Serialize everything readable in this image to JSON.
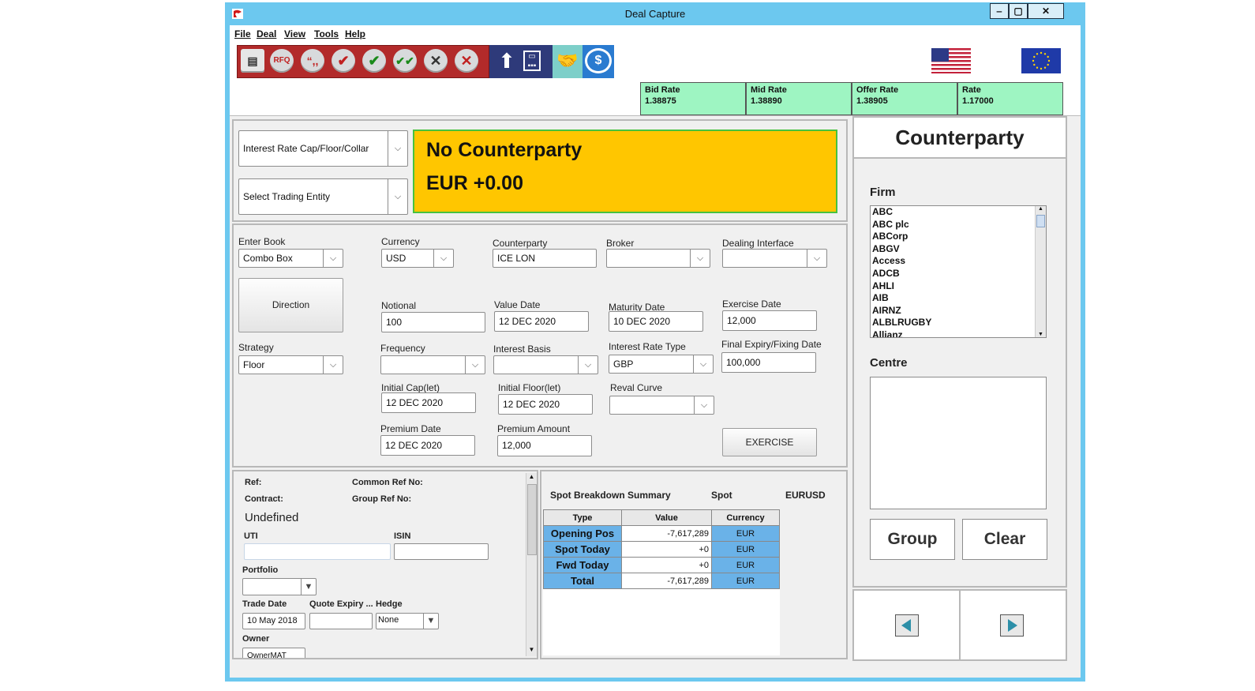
{
  "window": {
    "title": "Deal Capture",
    "controls": {
      "minimize": "‒",
      "maximize": "▢",
      "close": "✕"
    }
  },
  "menu": [
    "File",
    "Deal",
    "View",
    "Tools",
    "Help"
  ],
  "toolbar": {
    "rfq_label": "RFQ",
    "quote_label": "“,,",
    "icons": [
      "new-deal-icon",
      "rfq-icon",
      "quote-icon",
      "check-icon",
      "check-icon",
      "double-check-icon",
      "cancel-icon",
      "delete-icon",
      "upload-icon",
      "calculator-icon",
      "handshake-icon",
      "currency-refresh-icon"
    ]
  },
  "flags": {
    "left": "us-flag-icon",
    "right": "eu-flag-icon"
  },
  "rates": [
    {
      "label": "Bid Rate",
      "value": "1.38875"
    },
    {
      "label": "Mid Rate",
      "value": "1.38890"
    },
    {
      "label": "Offer Rate",
      "value": "1.38905"
    },
    {
      "label": "Rate",
      "value": "1.17000"
    }
  ],
  "deal_type": {
    "product": "Interest Rate Cap/Floor/Collar",
    "trading_entity": "Select Trading Entity"
  },
  "summary_banner": {
    "counterparty": "No Counterparty",
    "amount": "EUR +0.00"
  },
  "form": {
    "enter_book": {
      "label": "Enter Book",
      "value": "Combo Box"
    },
    "currency": {
      "label": "Currency",
      "value": "USD"
    },
    "counterparty": {
      "label": "Counterparty",
      "value": "ICE LON"
    },
    "broker": {
      "label": "Broker",
      "value": ""
    },
    "dealing_interface": {
      "label": "Dealing Interface",
      "value": ""
    },
    "direction_button": "Direction",
    "notional": {
      "label": "Notional",
      "value": "100"
    },
    "value_date": {
      "label": "Value Date",
      "value": "12 DEC 2020"
    },
    "maturity_date": {
      "label": "Maturity Date",
      "value": "10 DEC 2020"
    },
    "exercise_date": {
      "label": "Exercise Date",
      "value": "12,000"
    },
    "strategy": {
      "label": "Strategy",
      "value": "Floor"
    },
    "frequency": {
      "label": "Frequency",
      "value": ""
    },
    "interest_basis": {
      "label": "Interest Basis",
      "value": ""
    },
    "interest_rate_type": {
      "label": "Interest Rate Type",
      "value": "GBP"
    },
    "final_expiry": {
      "label": "Final Expiry/Fixing Date",
      "value": "100,000"
    },
    "initial_cap": {
      "label": "Initial Cap(let)",
      "value": "12 DEC 2020"
    },
    "initial_floor": {
      "label": "Initial Floor(let)",
      "value": "12 DEC 2020"
    },
    "reval_curve": {
      "label": "Reval Curve",
      "value": ""
    },
    "premium_date": {
      "label": "Premium Date",
      "value": "12 DEC 2020"
    },
    "premium_amount": {
      "label": "Premium Amount",
      "value": "12,000"
    },
    "exercise_button": "EXERCISE"
  },
  "ref_panel": {
    "ref_label": "Ref:",
    "common_ref_label": "Common Ref No:",
    "contract_label": "Contract:",
    "group_ref_label": "Group Ref No:",
    "status": "Undefined",
    "uti_label": "UTI",
    "uti_value": "",
    "isin_label": "ISIN",
    "isin_value": "",
    "portfolio_label": "Portfolio",
    "portfolio_value": "",
    "trade_date_label": "Trade Date",
    "trade_date_value": "10 May 2018",
    "quote_expiry_label": "Quote Expiry ...",
    "quote_expiry_value": "",
    "hedge_label": "Hedge",
    "hedge_value": "None",
    "owner_label": "Owner",
    "owner_value": "OwnerMAT"
  },
  "spot_breakdown": {
    "title": "Spot Breakdown Summary",
    "spot_label": "Spot",
    "pair": "EURUSD",
    "columns": [
      "Type",
      "Value",
      "Currency"
    ],
    "rows": [
      {
        "type": "Opening Pos",
        "value": "-7,617,289",
        "currency": "EUR"
      },
      {
        "type": "Spot Today",
        "value": "+0",
        "currency": "EUR"
      },
      {
        "type": "Fwd Today",
        "value": "+0",
        "currency": "EUR"
      },
      {
        "type": "Total",
        "value": "-7,617,289",
        "currency": "EUR"
      }
    ]
  },
  "counterparty_panel": {
    "title": "Counterparty",
    "firm_label": "Firm",
    "firms": [
      "ABC",
      "ABC plc",
      "ABCorp",
      "ABGV",
      "Access",
      "ADCB",
      "AHLI",
      "AIB",
      "AIRNZ",
      "ALBLRUGBY",
      "Allianz"
    ],
    "centre_label": "Centre",
    "group_button": "Group",
    "clear_button": "Clear"
  },
  "colors": {
    "window_frame": "#6cc8ef",
    "banner_bg": "#ffc600",
    "banner_border": "#47c23f",
    "rate_bg": "#9ef5c2",
    "table_highlight": "#6ab2e8",
    "toolbar_red": "#b22a2a"
  }
}
